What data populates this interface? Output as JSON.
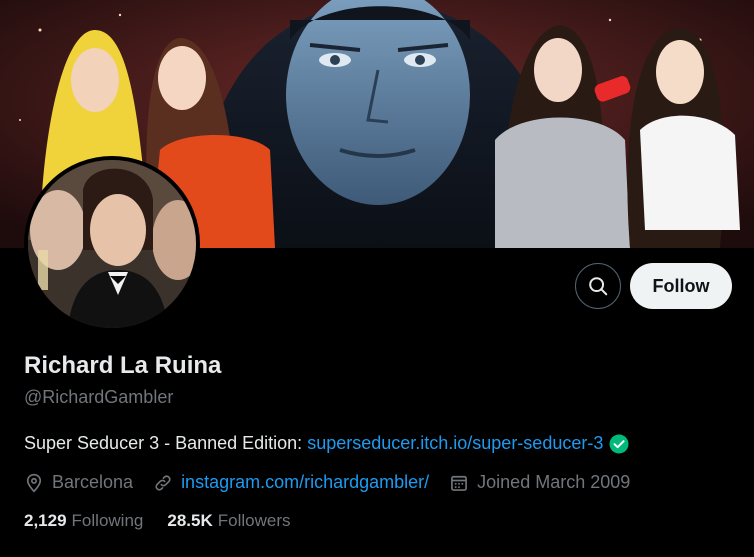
{
  "profile": {
    "display_name": "Richard La Ruina",
    "handle": "@RichardGambler",
    "bio_text": "Super Seducer 3 - Banned Edition: ",
    "bio_link": "superseducer.itch.io/super-seducer-3",
    "location": "Barcelona",
    "website": "instagram.com/richardgambler/",
    "joined": "Joined March 2009"
  },
  "actions": {
    "follow_label": "Follow"
  },
  "stats": {
    "following_count": "2,129",
    "following_label": "Following",
    "followers_count": "28.5K",
    "followers_label": "Followers"
  },
  "icons": {
    "search": "search-icon",
    "verified": "verified-check-icon",
    "location": "location-pin-icon",
    "link": "link-icon",
    "calendar": "calendar-icon"
  },
  "colors": {
    "background": "#000000",
    "primary_text": "#e7e9ea",
    "secondary_text": "#71767b",
    "link": "#1d9bf0",
    "follow_button_bg": "#eff3f4",
    "verified": "#00ba7c"
  }
}
